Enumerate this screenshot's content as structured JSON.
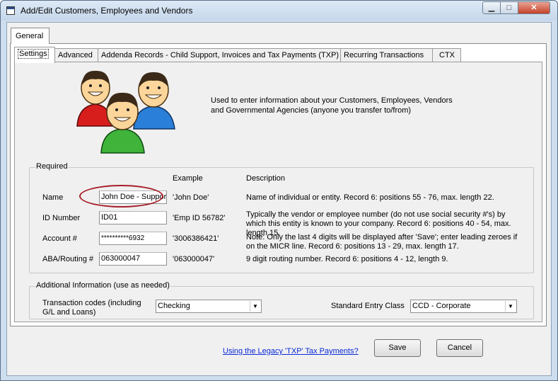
{
  "window": {
    "title": "Add/Edit Customers, Employees and Vendors",
    "minimize_glyph": "▁",
    "maximize_glyph": "□",
    "close_glyph": "✕"
  },
  "outer_tab": {
    "label": "General"
  },
  "tabs": [
    {
      "label": "Settings",
      "active": true
    },
    {
      "label": "Advanced",
      "active": false
    },
    {
      "label": "Addenda Records - Child Support, Invoices and Tax Payments (TXP)",
      "active": false
    },
    {
      "label": "Recurring Transactions",
      "active": false
    },
    {
      "label": "CTX",
      "active": false
    }
  ],
  "intro": {
    "icon": "people-group-icon",
    "text": "Used to enter information about your Customers, Employees, Vendors and Governmental Agencies (anyone you transfer to/from)"
  },
  "required": {
    "legend": "Required",
    "col_example": "Example",
    "col_description": "Description",
    "rows": [
      {
        "label": "Name",
        "value": "John Doe - Support",
        "example": "'John Doe'",
        "description": "Name of individual or entity. Record 6: positions 55 - 76, max. length 22."
      },
      {
        "label": "ID Number",
        "value": "ID01",
        "example": "'Emp ID 56782'",
        "description": "Typically the vendor or employee number (do not use social security #'s) by which this entity is known to your company. Record 6: positions 40 - 54, max. length 15."
      },
      {
        "label": "Account #",
        "value": "**********6932",
        "example": "'3006386421'",
        "description": "Note: Only the last 4 digits will be displayed after 'Save'; enter leading zeroes if on the MICR line. Record 6: positions 13 - 29, max. length 17."
      },
      {
        "label": "ABA/Routing #",
        "value": "063000047",
        "example": "'063000047'",
        "description": "9 digit routing number. Record 6: positions 4 - 12, length 9."
      }
    ]
  },
  "additional": {
    "legend": "Additional Information (use as needed)",
    "transaction_codes_label": "Transaction codes (including G/L and Loans)",
    "transaction_codes_value": "Checking",
    "sec_label": "Standard Entry Class",
    "sec_value": "CCD - Corporate"
  },
  "footer": {
    "legacy_link": "Using the Legacy 'TXP' Tax Payments?",
    "save_label": "Save",
    "cancel_label": "Cancel"
  },
  "colors": {
    "highlight": "#a8202a",
    "link": "#0b2ad6",
    "close_button": "#c5412a"
  }
}
